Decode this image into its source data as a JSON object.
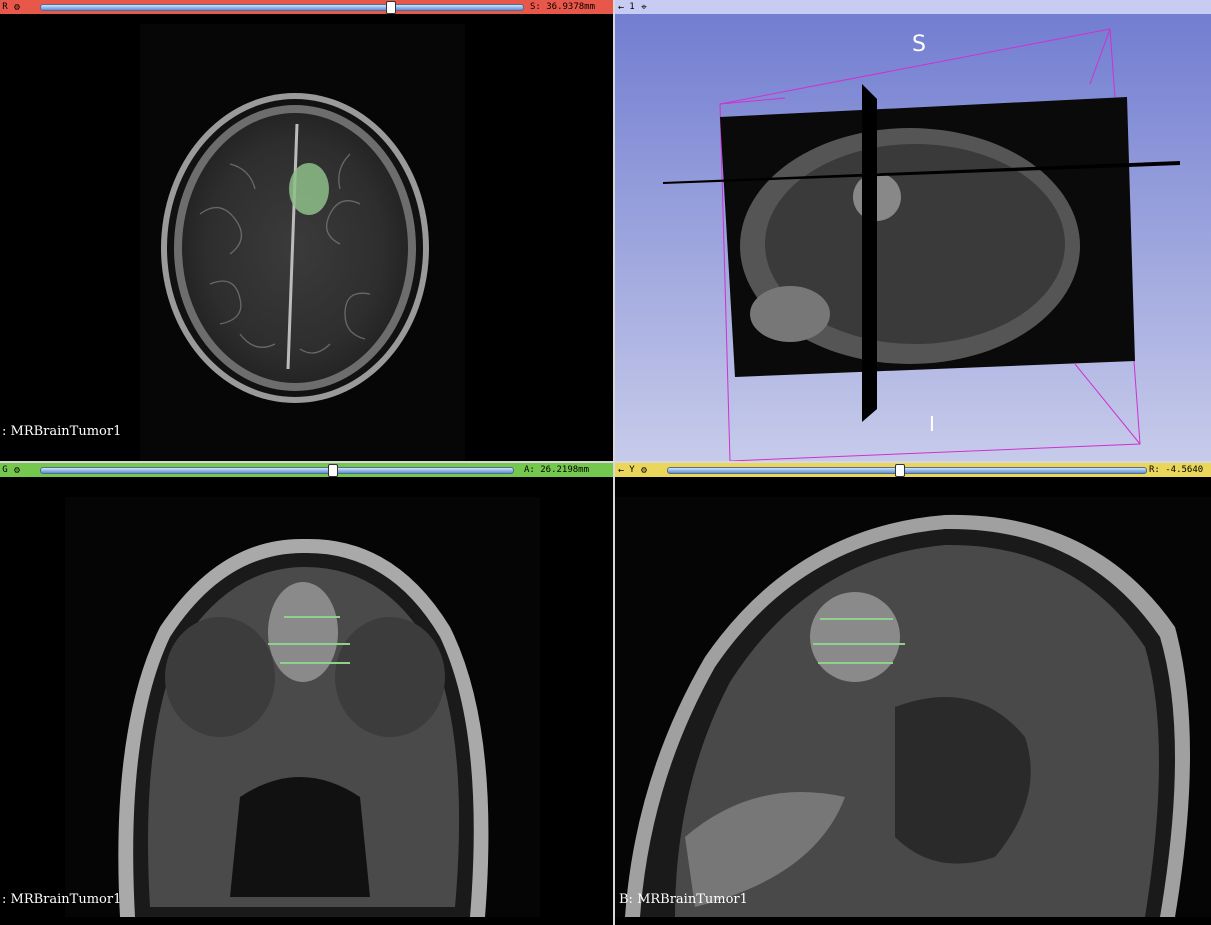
{
  "views": {
    "red": {
      "label": "R",
      "offset": "S: 36.9378mm",
      "slider_fraction": 0.73,
      "volume_label": ": MRBrainTumor1",
      "color": "#f0604a"
    },
    "threed": {
      "label": "1",
      "orient_top": "S",
      "orient_bottom": "I",
      "color": "#6f74c8"
    },
    "green": {
      "label": "G",
      "offset": "A: 26.2198mm",
      "slider_fraction": 0.61,
      "volume_label": ": MRBrainTumor1",
      "color": "#6cc04a"
    },
    "yellow": {
      "label": "Y",
      "offset": "R: -4.5640",
      "slider_fraction": 0.48,
      "volume_label": "B: MRBrainTumor1",
      "color": "#e9d65a"
    }
  },
  "icons": {
    "pin": "pin-icon",
    "link": "link-icon",
    "crosshair": "crosshair-icon"
  }
}
